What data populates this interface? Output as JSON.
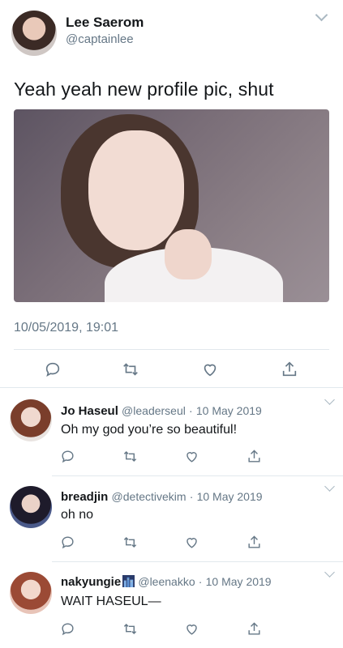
{
  "main_tweet": {
    "display_name": "Lee Saerom",
    "handle": "@captainlee",
    "text": "Yeah yeah new profile pic, shut",
    "timestamp": "10/05/2019, 19:01",
    "image_alt": "profile photo"
  },
  "replies": [
    {
      "display_name": "Jo Haseul",
      "handle": "@leaderseul",
      "separator": "·",
      "date": "10 May 2019",
      "text": "Oh my god you’re so beautiful!"
    },
    {
      "display_name": "breadjin",
      "handle": "@detectivekim",
      "separator": "·",
      "date": "10 May 2019",
      "text": "oh no"
    },
    {
      "display_name": "nakyungie",
      "handle": "@leenakko",
      "separator": "·",
      "date": "10 May 2019",
      "text": "WAIT HASEUL—",
      "badge": "city-night-emoji"
    }
  ],
  "icons": {
    "reply": "reply-icon",
    "retweet": "retweet-icon",
    "like": "like-icon",
    "share": "share-icon",
    "caret": "chevron-down-icon"
  },
  "colors": {
    "text": "#14171a",
    "secondary": "#657786",
    "divider": "#e1e8ed"
  }
}
